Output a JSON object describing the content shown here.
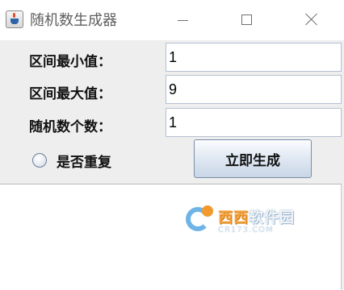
{
  "window": {
    "title": "随机数生成器",
    "icon": "java-cup-icon",
    "controls": [
      "minimize-icon",
      "maximize-icon",
      "close-icon"
    ]
  },
  "form": {
    "min": {
      "label": "区间最小值：",
      "value": "1"
    },
    "max": {
      "label": "区间最大值：",
      "value": "9"
    },
    "count": {
      "label": "随机数个数：",
      "value": "1"
    },
    "repeat": {
      "label": "是否重复",
      "checked": false
    },
    "generate_label": "立即生成"
  },
  "output": {
    "text": ""
  },
  "watermark": {
    "main_prefix": "西西",
    "main_suffix": "软件园",
    "sub": "CR173.COM"
  },
  "colors": {
    "panel": "#eeeeee",
    "input_border": "#b4c1d2",
    "button_top": "#fbfcfe",
    "button_bottom": "#c9d6e6"
  }
}
